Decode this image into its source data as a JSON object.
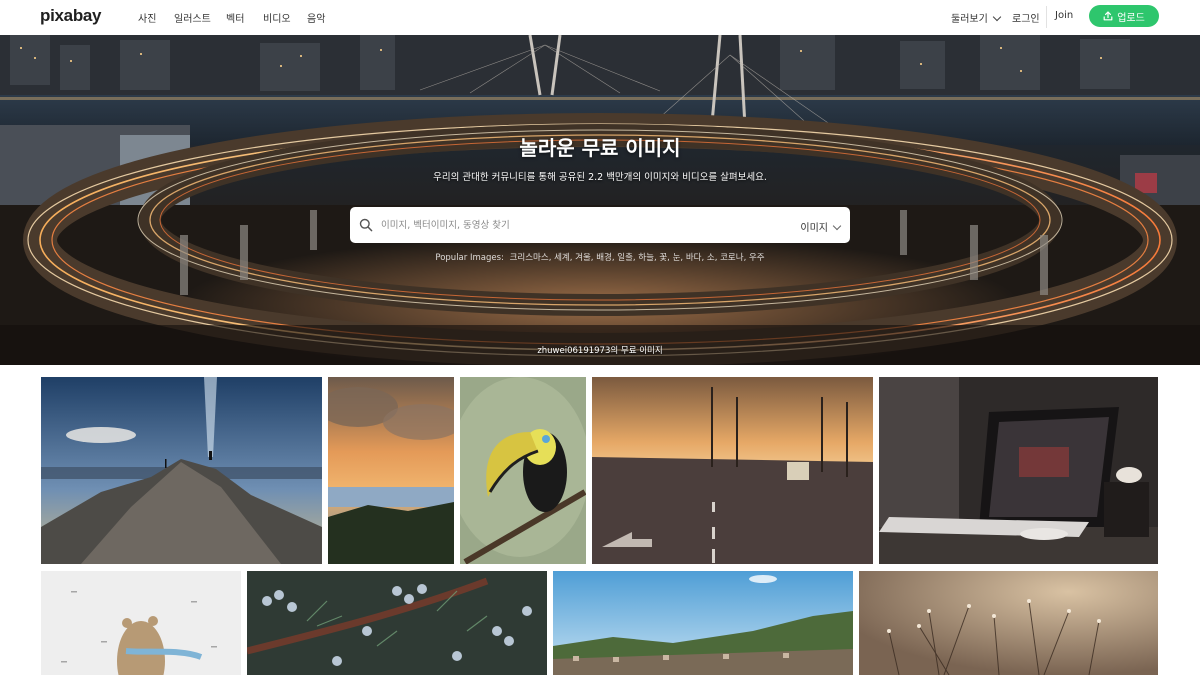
{
  "brand": {
    "logo": "pixabay"
  },
  "nav": {
    "items": [
      "사진",
      "일러스트",
      "벡터",
      "비디오",
      "음악"
    ],
    "explore": "둘러보기",
    "login": "로그인",
    "join": "Join",
    "upload": "업로드"
  },
  "hero": {
    "title": "놀라운 무료 이미지",
    "subtitle": "우리의 관대한 커뮤니티를 통해 공유된 2.2 백만개의 이미지와 비디오를 살펴보세요.",
    "search": {
      "placeholder": "이미지, 벡터이미지, 동영상 찾기",
      "value": "",
      "type": "이미지"
    },
    "popular": {
      "label": "Popular Images:",
      "terms": [
        "크리스마스",
        "세계",
        "겨울",
        "배경",
        "일출",
        "하늘",
        "꽃",
        "눈",
        "바다",
        "소",
        "코로나",
        "우주"
      ]
    },
    "credit": "zhuwei06191973의 무료 이미지"
  },
  "gallery": {
    "images": [
      {
        "subject": "mountain-summit-light-beam"
      },
      {
        "subject": "sunset-clouds-over-sea"
      },
      {
        "subject": "toucan-on-branch"
      },
      {
        "subject": "street-at-sunset"
      },
      {
        "subject": "laptop-on-desk"
      },
      {
        "subject": "bear-with-scarf-illustration"
      },
      {
        "subject": "juniper-berries-branch"
      },
      {
        "subject": "town-and-hills"
      },
      {
        "subject": "dried-flowers-bokeh"
      }
    ]
  },
  "colors": {
    "accent": "#2ec66d",
    "hero_text": "#ffffff",
    "nav_text": "#333333"
  }
}
